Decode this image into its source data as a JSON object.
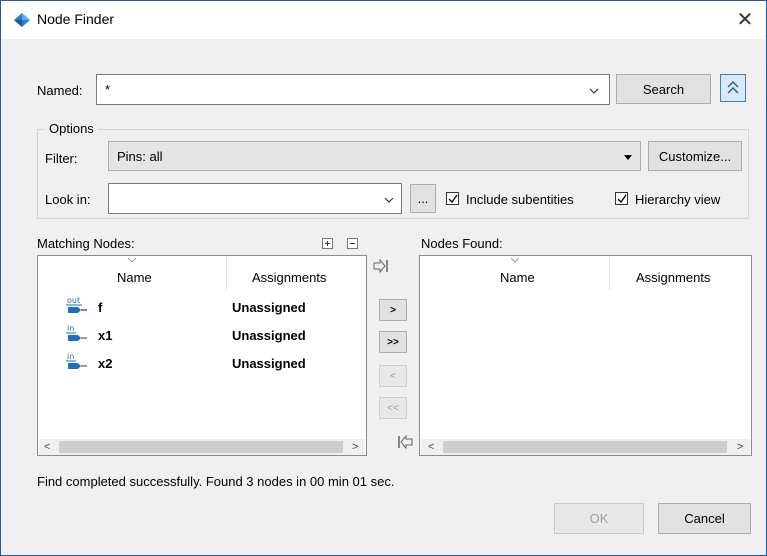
{
  "window": {
    "title": "Node Finder",
    "close_glyph": "✕"
  },
  "named": {
    "label": "Named:",
    "value": "*"
  },
  "search_button": "Search",
  "options": {
    "group_label": "Options",
    "filter_label": "Filter:",
    "filter_value": "Pins: all",
    "customize_button": "Customize...",
    "lookin_label": "Look in:",
    "lookin_value": "",
    "browse_button": "...",
    "include_subentities": {
      "label": "Include subentities",
      "checked": true
    },
    "hierarchy_view": {
      "label": "Hierarchy view",
      "checked": true
    }
  },
  "matching": {
    "label": "Matching Nodes:",
    "columns": [
      "Name",
      "Assignments"
    ],
    "rows": [
      {
        "icon": "output-pin-icon",
        "icon_text": "out",
        "name": "f",
        "assignment": "Unassigned"
      },
      {
        "icon": "input-pin-icon",
        "icon_text": "in",
        "name": "x1",
        "assignment": "Unassigned"
      },
      {
        "icon": "input-pin-icon",
        "icon_text": "in",
        "name": "x2",
        "assignment": "Unassigned"
      }
    ]
  },
  "found": {
    "label": "Nodes Found:",
    "columns": [
      "Name",
      "Assignments"
    ]
  },
  "move_buttons": {
    "add": ">",
    "add_all": ">>",
    "remove": "<",
    "remove_all": "<<"
  },
  "status": "Find completed successfully. Found 3 nodes in 00 min 01 sec.",
  "footer": {
    "ok": "OK",
    "cancel": "Cancel"
  },
  "colors": {
    "accent": "#1f5aa6",
    "pin_blue": "#1e6fc2",
    "pin_red": "#cc2222"
  }
}
